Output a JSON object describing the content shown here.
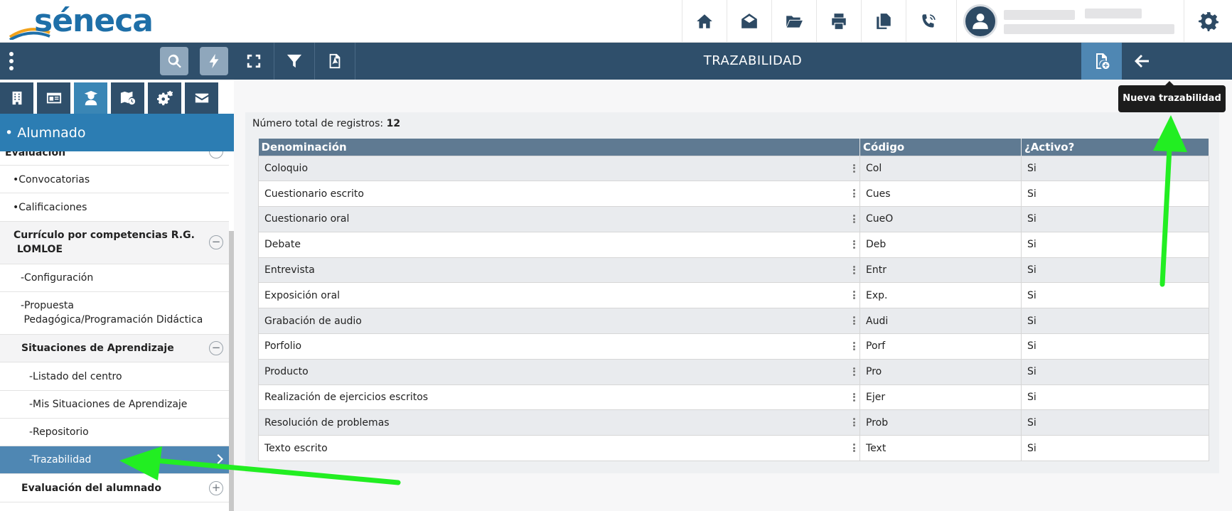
{
  "header": {
    "logo_text": "séneca",
    "icons": [
      "home-icon",
      "envelope-open-icon",
      "folder-open-icon",
      "print-icon",
      "copy-icon",
      "phone-icon"
    ],
    "settings_icon": "gear-icon"
  },
  "sidebar": {
    "toolbar_icons": [
      "kebab-icon",
      "search-icon",
      "bolt-icon"
    ],
    "tabs": [
      "building-icon",
      "id-card-icon",
      "student-icon",
      "map-icon",
      "cogs-icon",
      "envelope-icon"
    ],
    "active_tab": 2,
    "section_title": "• Alumnado",
    "items": [
      {
        "label": "Evaluación",
        "kind": "group",
        "control": "−"
      },
      {
        "label": "•Convocatorias",
        "kind": "item"
      },
      {
        "label": "•Calificaciones",
        "kind": "item"
      },
      {
        "label_line1": "Currículo por competencias R.G.",
        "label_line2": " LOMLOE",
        "kind": "group",
        "control": "−"
      },
      {
        "label": "-Configuración",
        "kind": "subitem"
      },
      {
        "label_line1": "-Propuesta",
        "label_line2": " Pedagógica/Programación Didáctica",
        "kind": "subitem"
      },
      {
        "label": "Situaciones de Aprendizaje",
        "kind": "subgroup",
        "control": "−"
      },
      {
        "label": "-Listado del centro",
        "kind": "leaf"
      },
      {
        "label": "-Mis Situaciones de Aprendizaje",
        "kind": "leaf"
      },
      {
        "label": "-Repositorio",
        "kind": "leaf"
      },
      {
        "label": "-Trazabilidad",
        "kind": "leaf",
        "active": true
      },
      {
        "label": "Evaluación del alumnado",
        "kind": "subgroup",
        "control": "+"
      }
    ]
  },
  "toolbar": {
    "title": "TRAZABILIDAD",
    "buttons": [
      "expand-icon",
      "filter-icon",
      "pdf-icon"
    ],
    "new_button_icon": "file-plus-icon",
    "back_icon": "arrow-left-icon",
    "tooltip": "Nueva trazabilidad"
  },
  "content": {
    "count_label": "Número total de registros:",
    "count_value": "12",
    "columns": [
      "Denominación",
      "Código",
      "¿Activo?"
    ],
    "rows": [
      {
        "name": "Coloquio",
        "code": "Col",
        "active": "Si"
      },
      {
        "name": "Cuestionario escrito",
        "code": "Cues",
        "active": "Si"
      },
      {
        "name": "Cuestionario oral",
        "code": "CueO",
        "active": "Si"
      },
      {
        "name": "Debate",
        "code": "Deb",
        "active": "Si"
      },
      {
        "name": "Entrevista",
        "code": "Entr",
        "active": "Si"
      },
      {
        "name": "Exposición oral",
        "code": "Exp.",
        "active": "Si"
      },
      {
        "name": "Grabación de audio",
        "code": "Audi",
        "active": "Si"
      },
      {
        "name": "Porfolio",
        "code": "Porf",
        "active": "Si"
      },
      {
        "name": "Producto",
        "code": "Pro",
        "active": "Si"
      },
      {
        "name": "Realización de ejercicios escritos",
        "code": "Ejer",
        "active": "Si"
      },
      {
        "name": "Resolución de problemas",
        "code": "Prob",
        "active": "Si"
      },
      {
        "name": "Texto escrito",
        "code": "Text",
        "active": "Si"
      }
    ]
  },
  "colors": {
    "brand": "#1e6fa8",
    "toolbar": "#2f4f6b",
    "active": "#4f87b3",
    "arrow": "#22ee22"
  }
}
